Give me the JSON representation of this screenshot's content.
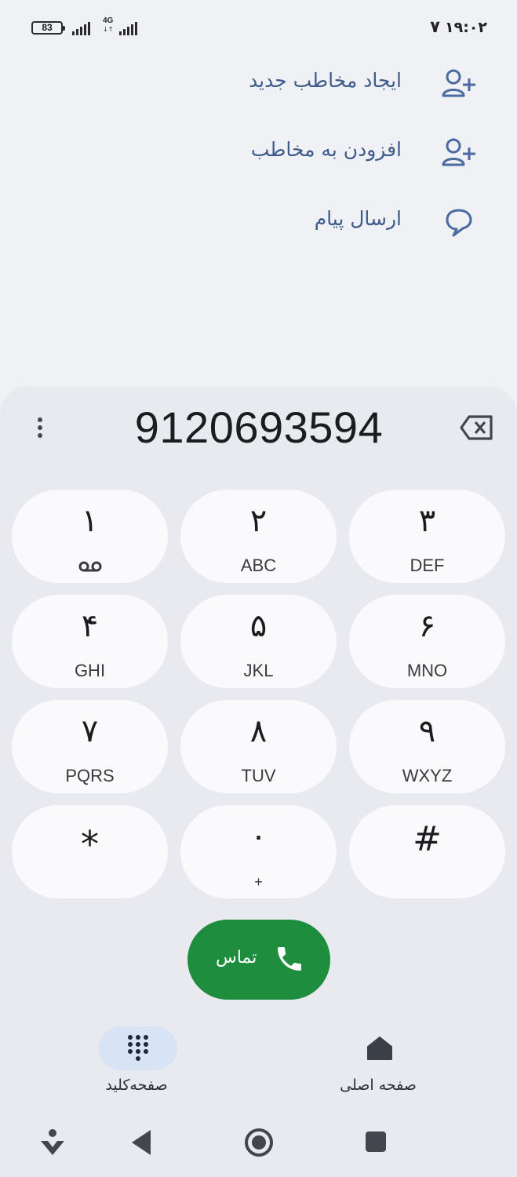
{
  "status_bar": {
    "battery_level": "83",
    "network_type": "4G",
    "network_arrows": "↓↑",
    "clock": "۱۹:۰۲",
    "notification_digit": "۷"
  },
  "actions": [
    {
      "label": "ایجاد مخاطب جدید",
      "icon": "add-person-icon"
    },
    {
      "label": "افزودن به مخاطب",
      "icon": "add-person-icon"
    },
    {
      "label": "ارسال پیام",
      "icon": "message-bubble-icon"
    }
  ],
  "dialer": {
    "number": "9120693594",
    "keys": [
      {
        "digit": "۱",
        "letters": "",
        "voicemail": true
      },
      {
        "digit": "۲",
        "letters": "ABC"
      },
      {
        "digit": "۳",
        "letters": "DEF"
      },
      {
        "digit": "۴",
        "letters": "GHI"
      },
      {
        "digit": "۵",
        "letters": "JKL"
      },
      {
        "digit": "۶",
        "letters": "MNO"
      },
      {
        "digit": "۷",
        "letters": "PQRS"
      },
      {
        "digit": "۸",
        "letters": "TUV"
      },
      {
        "digit": "۹",
        "letters": "WXYZ"
      },
      {
        "digit": "*",
        "letters": ""
      },
      {
        "digit": "۰",
        "letters": "+"
      },
      {
        "digit": "#",
        "letters": ""
      }
    ],
    "call_label": "تماس"
  },
  "bottom_nav": {
    "keypad_label": "صفحه‌کلید",
    "home_label": "صفحه اصلی"
  },
  "colors": {
    "background": "#eff1f5",
    "panel": "#e8eaef",
    "key": "#fafafc",
    "call_green": "#1e8e3e",
    "action_text": "#3d5a8a",
    "nav_active_pill": "#d9e3f6"
  }
}
